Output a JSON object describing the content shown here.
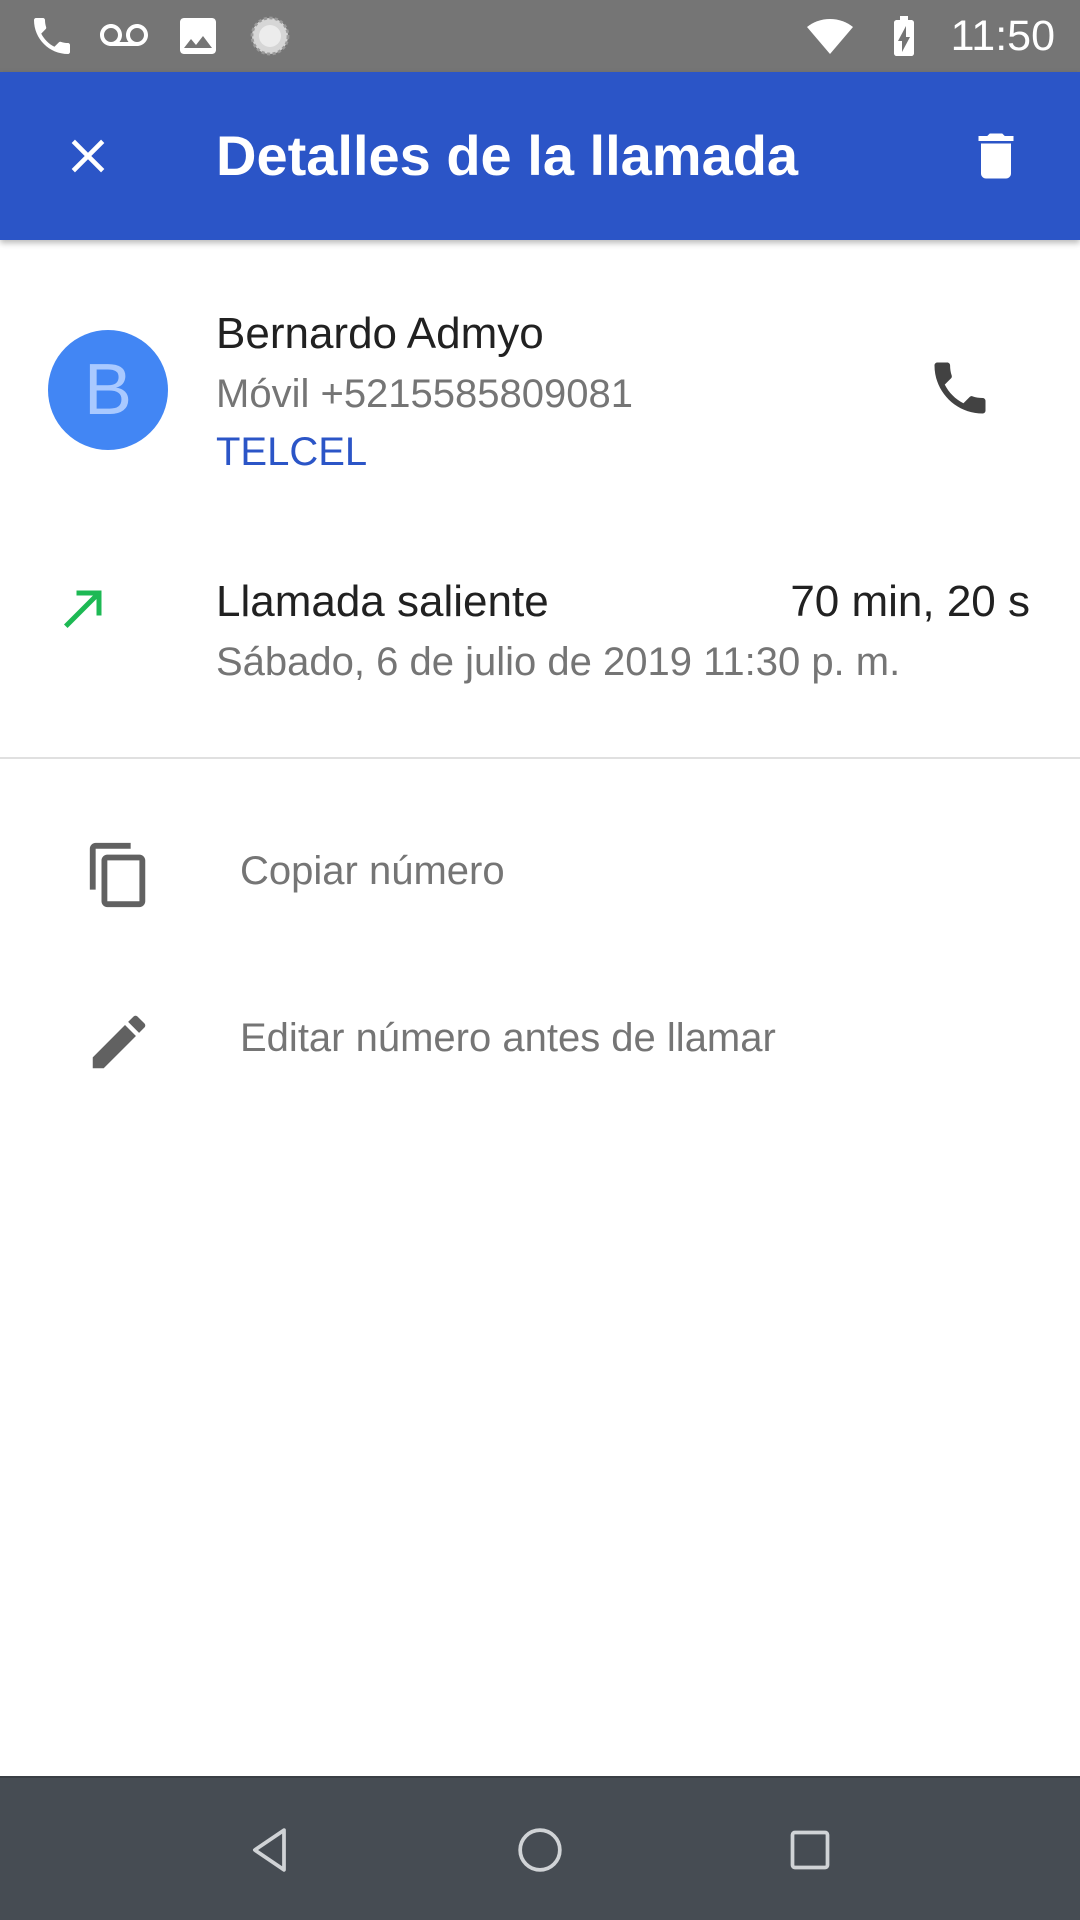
{
  "status_bar": {
    "time": "11:50",
    "icons": [
      "phone-icon",
      "voicemail-icon",
      "image-icon",
      "sync-icon",
      "wifi-icon",
      "battery-charging-icon"
    ]
  },
  "app_bar": {
    "title": "Detalles de la llamada",
    "close_icon": "close-icon",
    "delete_icon": "trash-icon",
    "color": "#2b55c7"
  },
  "contact": {
    "avatar_letter": "B",
    "avatar_color": "#4286f4",
    "name": "Bernardo Admyo",
    "number": "Móvil +5215585809081",
    "carrier": "TELCEL",
    "call_icon": "phone-icon"
  },
  "call_entry": {
    "type": "Llamada saliente",
    "type_icon": "outgoing-arrow-icon",
    "type_icon_color": "#1db954",
    "duration": "70 min, 20 s",
    "date": "Sábado, 6 de julio de 2019 11:30 p. m."
  },
  "actions": [
    {
      "label": "Copiar número",
      "icon": "copy-icon"
    },
    {
      "label": "Editar número antes de llamar",
      "icon": "edit-icon"
    }
  ],
  "nav_bar": {
    "buttons": [
      "back-icon",
      "home-icon",
      "recents-icon"
    ]
  }
}
